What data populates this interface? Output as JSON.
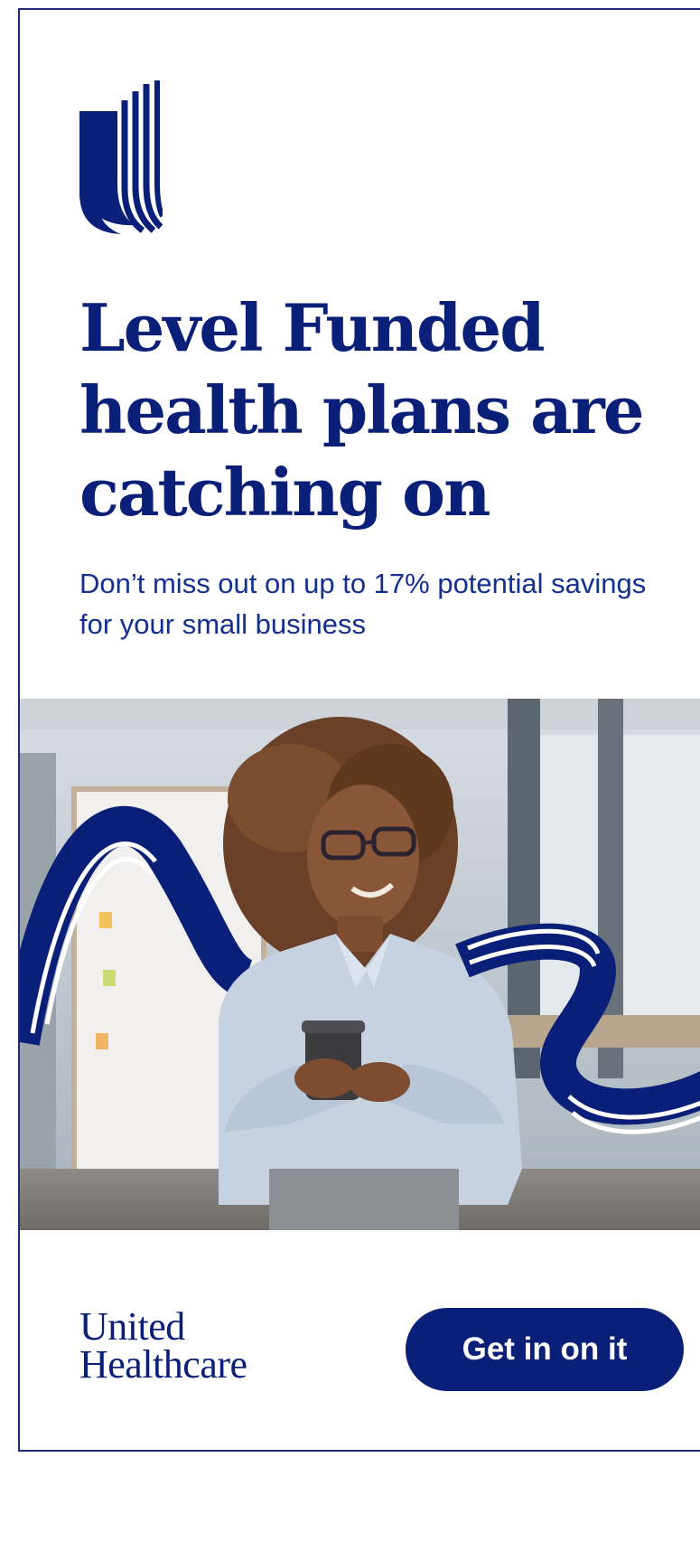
{
  "ad": {
    "headline": "Level Funded health plans are catching on",
    "subhead": "Don’t miss out on up to 17% potential savings for your small business",
    "brand": {
      "line1": "United",
      "line2": "Healthcare"
    },
    "cta_label": "Get in on it",
    "colors": {
      "brand_blue": "#0a1f78",
      "text_blue": "#13308f",
      "border": "#1e2c7a",
      "background": "#ffffff"
    },
    "icons": {
      "logo_mark": "uhc-u-logo-icon"
    }
  }
}
